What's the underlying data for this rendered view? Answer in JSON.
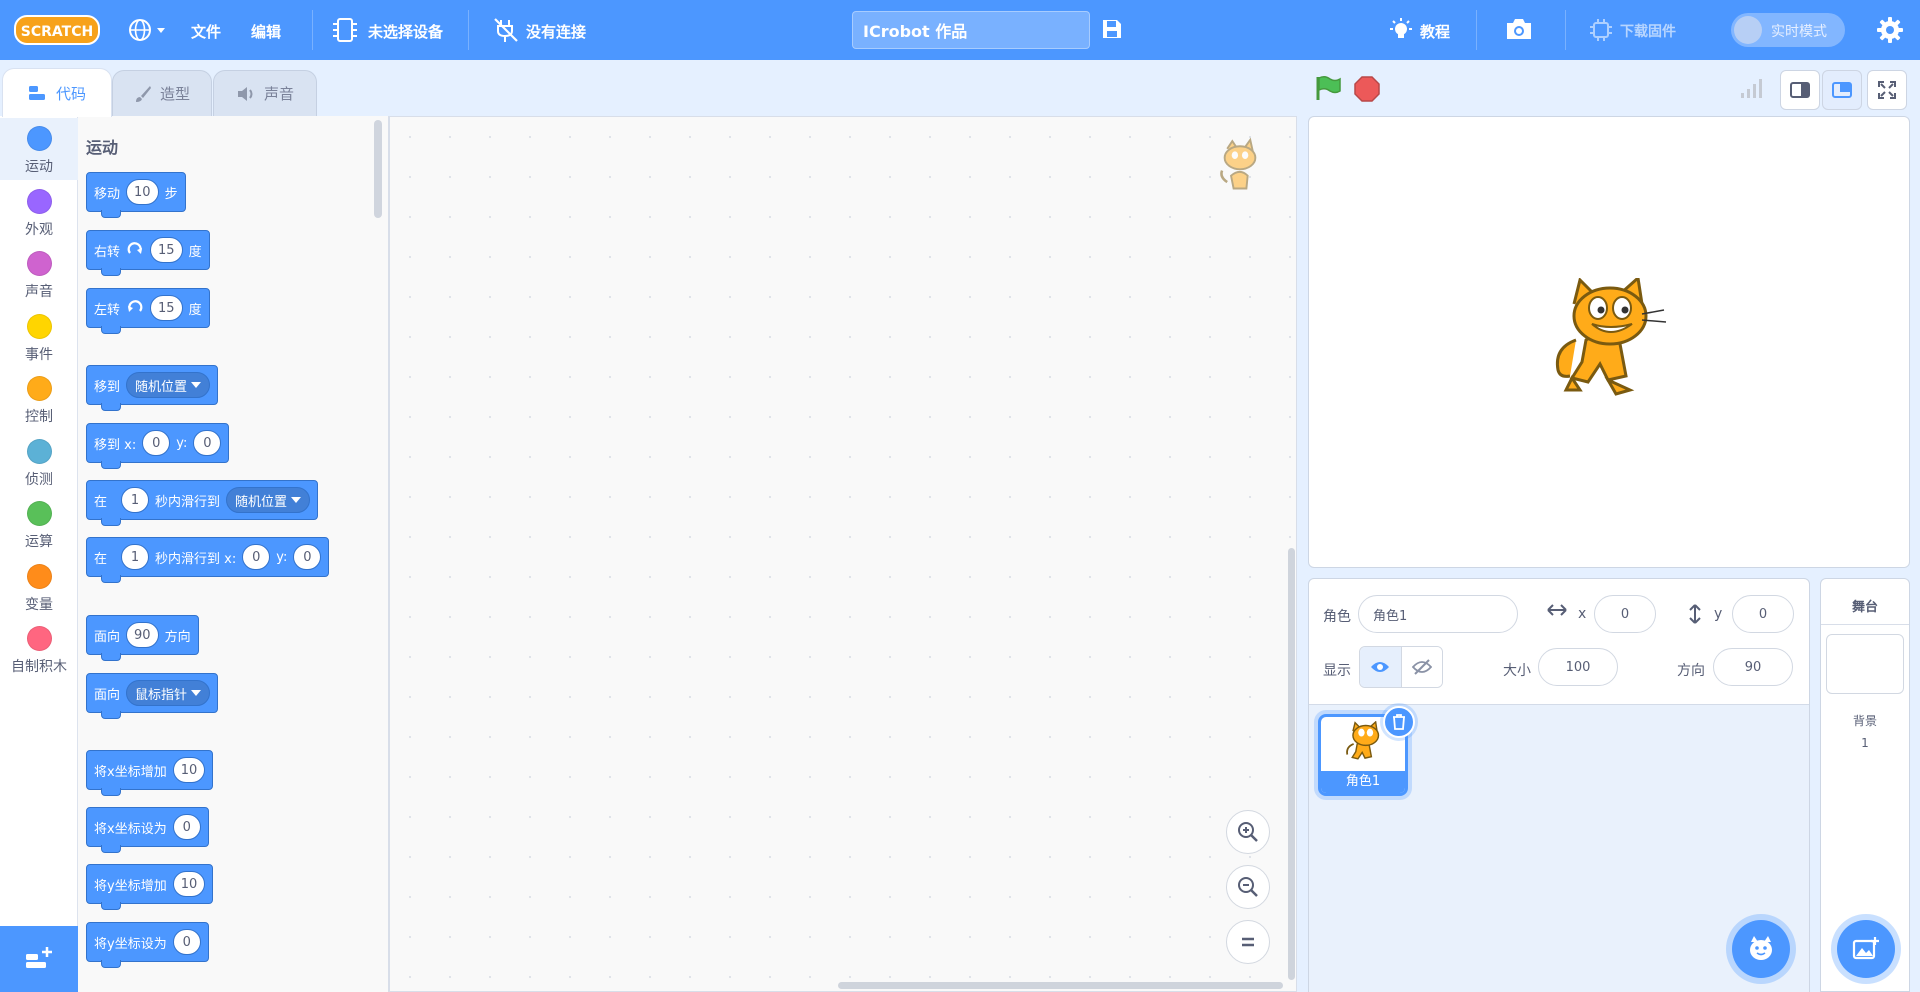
{
  "menu": {
    "logo_text": "SCRATCH",
    "file": "文件",
    "edit": "编辑",
    "device": "未选择设备",
    "connection": "没有连接",
    "project_title": "ICrobot 作品",
    "tutorials": "教程",
    "firmware": "下载固件",
    "realtime_mode": "实时模式"
  },
  "tabs": {
    "code": "代码",
    "costumes": "造型",
    "sounds": "声音"
  },
  "categories": [
    {
      "label": "运动",
      "color": "#4c97ff"
    },
    {
      "label": "外观",
      "color": "#9966ff"
    },
    {
      "label": "声音",
      "color": "#cf63cf"
    },
    {
      "label": "事件",
      "color": "#ffd500"
    },
    {
      "label": "控制",
      "color": "#ffab19"
    },
    {
      "label": "侦测",
      "color": "#5cb1d6"
    },
    {
      "label": "运算",
      "color": "#59c059"
    },
    {
      "label": "变量",
      "color": "#ff8c1a"
    },
    {
      "label": "自制积木",
      "color": "#ff6680"
    }
  ],
  "palette": {
    "heading": "运动",
    "b_move": {
      "a": "移动",
      "v": "10",
      "b": "步"
    },
    "b_turn_right": {
      "a": "右转",
      "v": "15",
      "b": "度"
    },
    "b_turn_left": {
      "a": "左转",
      "v": "15",
      "b": "度"
    },
    "b_goto": {
      "a": "移到",
      "dd": "随机位置"
    },
    "b_goto_xy": {
      "a": "移到 x:",
      "x": "0",
      "b": "y:",
      "y": "0"
    },
    "b_glide": {
      "a": "在",
      "v": "1",
      "b": "秒内滑行到",
      "dd": "随机位置"
    },
    "b_glide_xy": {
      "a": "在",
      "v": "1",
      "b": "秒内滑行到 x:",
      "x": "0",
      "c": "y:",
      "y": "0"
    },
    "b_point": {
      "a": "面向",
      "v": "90",
      "b": "方向"
    },
    "b_point_towards": {
      "a": "面向",
      "dd": "鼠标指针"
    },
    "b_change_x": {
      "a": "将x坐标增加",
      "v": "10"
    },
    "b_set_x": {
      "a": "将x坐标设为",
      "v": "0"
    },
    "b_change_y": {
      "a": "将y坐标增加",
      "v": "10"
    },
    "b_set_y": {
      "a": "将y坐标设为",
      "v": "0"
    }
  },
  "sprite_info": {
    "sprite_label": "角色",
    "sprite_name": "角色1",
    "x_label": "x",
    "x_value": "0",
    "y_label": "y",
    "y_value": "0",
    "show_label": "显示",
    "size_label": "大小",
    "size_value": "100",
    "direction_label": "方向",
    "direction_value": "90"
  },
  "sprites": [
    {
      "name": "角色1"
    }
  ],
  "stage_pane": {
    "title": "舞台",
    "backdrops_label": "背景",
    "backdrops_count": "1"
  }
}
